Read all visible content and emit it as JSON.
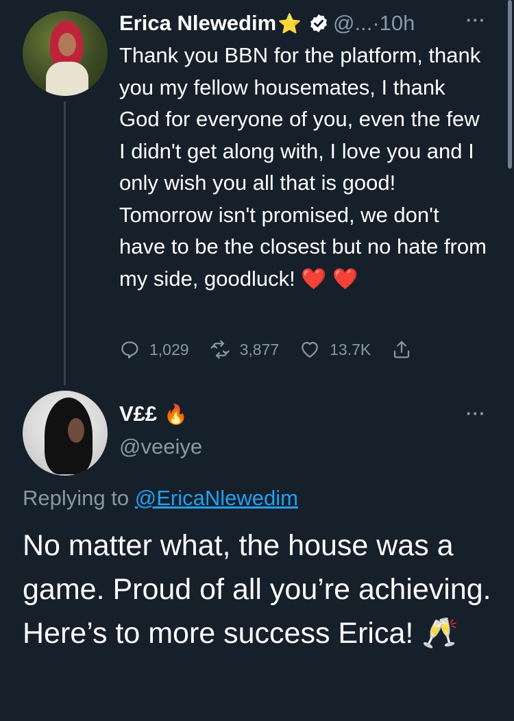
{
  "parent": {
    "name": "Erica Nlewedim",
    "name_emoji": "⭐",
    "handle": "@...",
    "separator": "·",
    "time": "10h",
    "more": "···",
    "text": "Thank you BBN for the platform, thank you my fellow housemates, I thank God for everyone of you, even the few I didn't get along with, I love you and I only wish you all that is good! Tomorrow isn't promised, we don't have to be the closest but no hate from my side, goodluck!",
    "text_emoji": "❤️ ❤️",
    "replies": "1,029",
    "retweets": "3,877",
    "likes": "13.7K"
  },
  "reply": {
    "name": "V££",
    "name_emoji": "🔥",
    "handle": "@veeiye",
    "more": "···",
    "replying_prefix": "Replying to",
    "replying_to": "@EricaNlewedim",
    "text": "No matter what, the house was a game. Proud of all you’re achieving. Here’s to more success Erica!",
    "text_emoji": "🥂"
  },
  "colors": {
    "background": "#15202b",
    "secondary_text": "#8899a6",
    "link": "#1da1f2",
    "heart": "#e0245e"
  }
}
